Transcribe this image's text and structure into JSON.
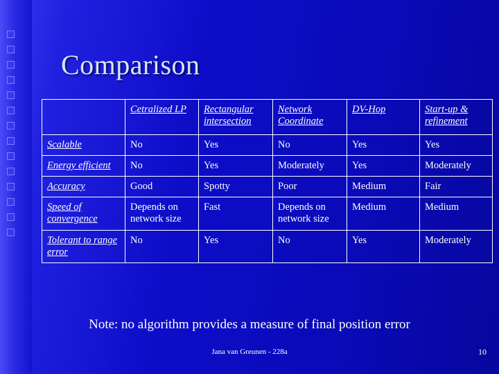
{
  "slide": {
    "title": "Comparison",
    "note": "Note: no algorithm provides a measure of final position error",
    "footer_author": "Jana van Greunen - 228a",
    "page_number": "10",
    "background_color": "#0a0ad0",
    "accent_color": "#ffffff"
  },
  "table": {
    "corner": "",
    "columns": [
      "Cetralized LP",
      "Rectangular intersection",
      "Network Coordinate",
      "DV-Hop",
      "Start-up & refinement"
    ],
    "rows": [
      {
        "header": "Scalable",
        "cells": [
          "No",
          "Yes",
          "No",
          "Yes",
          "Yes"
        ]
      },
      {
        "header": "Energy efficient",
        "cells": [
          "No",
          "Yes",
          "Moderately",
          "Yes",
          "Moderately"
        ]
      },
      {
        "header": "Accuracy",
        "cells": [
          "Good",
          "Spotty",
          "Poor",
          "Medium",
          "Fair"
        ]
      },
      {
        "header": "Speed of convergence",
        "cells": [
          "Depends on network size",
          "Fast",
          "Depends on network size",
          "Medium",
          "Medium"
        ]
      },
      {
        "header": "Tolerant to range error",
        "cells": [
          "No",
          "Yes",
          "No",
          "Yes",
          "Moderately"
        ]
      }
    ]
  }
}
